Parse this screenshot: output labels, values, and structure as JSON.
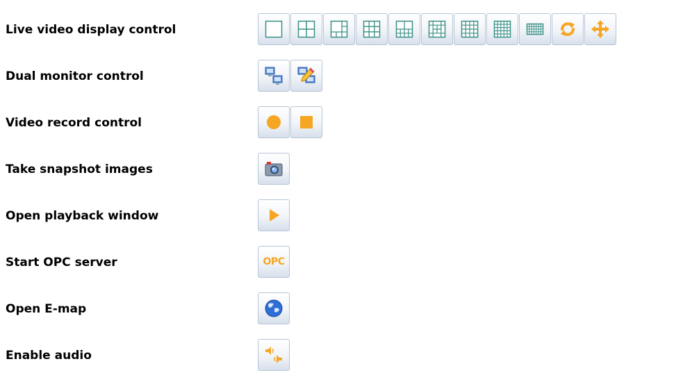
{
  "rows": [
    {
      "label": "Live video display control",
      "icons": [
        "layout-1-icon",
        "layout-4-icon",
        "layout-6-icon",
        "layout-9-icon",
        "layout-10-icon",
        "layout-13-icon",
        "layout-16-icon",
        "layout-25-icon",
        "layout-36-icon",
        "refresh-icon",
        "move-icon"
      ]
    },
    {
      "label": "Dual monitor control",
      "icons": [
        "dual-monitor-icon",
        "dual-monitor-edit-icon"
      ]
    },
    {
      "label": "Video record control",
      "icons": [
        "record-icon",
        "stop-icon"
      ]
    },
    {
      "label": "Take snapshot images",
      "icons": [
        "camera-icon"
      ]
    },
    {
      "label": "Open playback window",
      "icons": [
        "play-icon"
      ]
    },
    {
      "label": "Start OPC server",
      "icons": [
        "opc-icon"
      ]
    },
    {
      "label": "Open E-map",
      "icons": [
        "globe-icon"
      ]
    },
    {
      "label": "Enable audio",
      "icons": [
        "audio-icon"
      ]
    }
  ],
  "opc_text": "OPC",
  "colors": {
    "grid": "#3a8f86",
    "orange": "#f5a623",
    "border": "#b6c4d6"
  }
}
